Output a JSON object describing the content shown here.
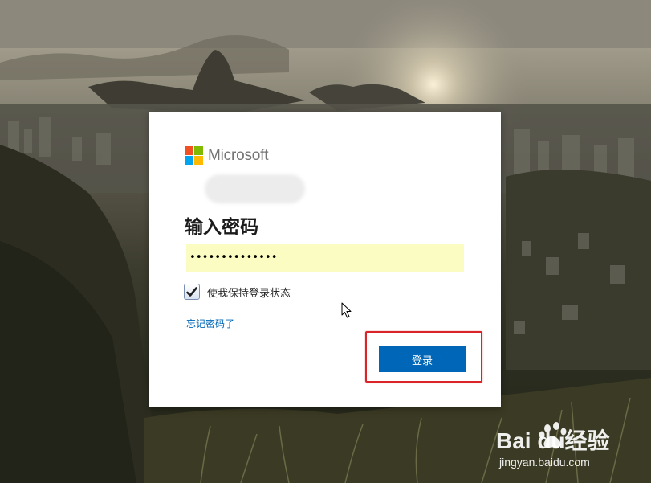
{
  "brand": {
    "name": "Microsoft",
    "logo_colors": [
      "#f25022",
      "#7fba00",
      "#00a4ef",
      "#ffb900"
    ]
  },
  "login": {
    "heading": "输入密码",
    "password_value": "••••••••••••••",
    "keep_signed_in_label": "使我保持登录状态",
    "keep_signed_in_checked": true,
    "forgot_password_link": "忘记密码了",
    "signin_button": "登录",
    "accent_color": "#0067b8"
  },
  "watermark": {
    "logo_text": "Bai du经验",
    "url": "jingyan.baidu.com"
  }
}
